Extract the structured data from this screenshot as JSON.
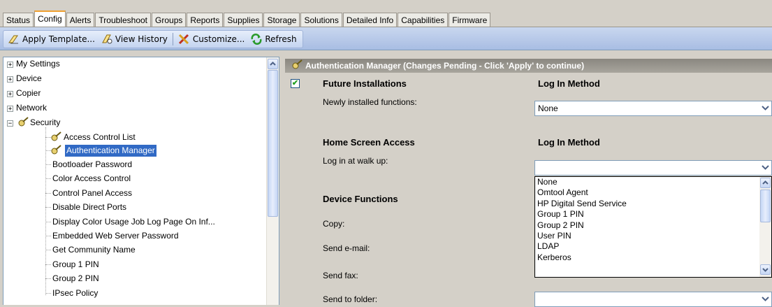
{
  "tabs": [
    "Status",
    "Config",
    "Alerts",
    "Troubleshoot",
    "Groups",
    "Reports",
    "Supplies",
    "Storage",
    "Solutions",
    "Detailed Info",
    "Capabilities",
    "Firmware"
  ],
  "active_tab": "Config",
  "toolbar": {
    "apply_template": "Apply Template...",
    "view_history": "View History",
    "customize": "Customize...",
    "refresh": "Refresh"
  },
  "tree": {
    "top": [
      "My Settings",
      "Device",
      "Copier",
      "Network",
      "Security"
    ],
    "security_children": [
      "Access Control List",
      "Authentication Manager",
      "Bootloader Password",
      "Color Access Control",
      "Control Panel Access",
      "Disable Direct Ports",
      "Display Color Usage Job Log Page On Inf...",
      "Embedded Web Server Password",
      "Get Community Name",
      "Group 1 PIN",
      "Group 2 PIN",
      "IPsec Policy"
    ],
    "selected": "Authentication Manager"
  },
  "panel": {
    "title": "Authentication Manager (Changes Pending - Click 'Apply' to continue)",
    "future_installations": "Future Installations",
    "log_in_method": "Log In Method",
    "newly_installed": "Newly installed functions:",
    "newly_installed_value": "None",
    "home_screen_access": "Home Screen Access",
    "log_in_method_2": "Log In Method",
    "log_in_walk_up": "Log in at walk up:",
    "log_in_walk_up_value": "",
    "device_functions": "Device Functions",
    "copy": "Copy:",
    "send_email": "Send e-mail:",
    "send_fax": "Send fax:",
    "send_to_folder": "Send to folder:"
  },
  "dropdown_options": [
    "None",
    "Omtool Agent",
    "HP Digital Send Service",
    "Group 1 PIN",
    "Group 2 PIN",
    "User PIN",
    "LDAP",
    "Kerberos"
  ],
  "colors": {
    "selection": "#316ac5",
    "accent_tab": "#f0a030",
    "check": "#21a121"
  }
}
